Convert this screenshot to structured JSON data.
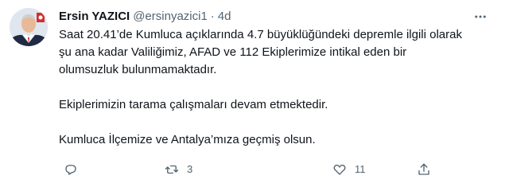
{
  "tweet": {
    "author": {
      "display_name": "Ersin YAZICI",
      "handle": "@ersinyazici1",
      "avatar_icon": "user-avatar"
    },
    "separator": "·",
    "time": "4d",
    "more_icon": "more-horizontal-icon",
    "text": {
      "line1": "Saat 20.41’de Kumluca açıklarında 4.7 büyüklüğündeki depremle ilgili olarak",
      "line2": "şu ana kadar Valiliğimiz, AFAD ve 112 Ekiplerimize intikal eden bir",
      "line3": "olumsuzluk bulunmamaktadır.",
      "paragraph2": "Ekiplerimizin tarama çalışmaları devam etmektedir.",
      "paragraph3": "Kumluca İlçemize ve Antalya’mıza geçmiş olsun."
    },
    "actions": {
      "reply": {
        "icon": "reply-icon",
        "count": ""
      },
      "retweet": {
        "icon": "retweet-icon",
        "count": "3"
      },
      "like": {
        "icon": "heart-icon",
        "count": "11"
      },
      "share": {
        "icon": "share-icon",
        "count": ""
      }
    },
    "colors": {
      "text": "#0f1419",
      "secondary": "#536471"
    }
  }
}
